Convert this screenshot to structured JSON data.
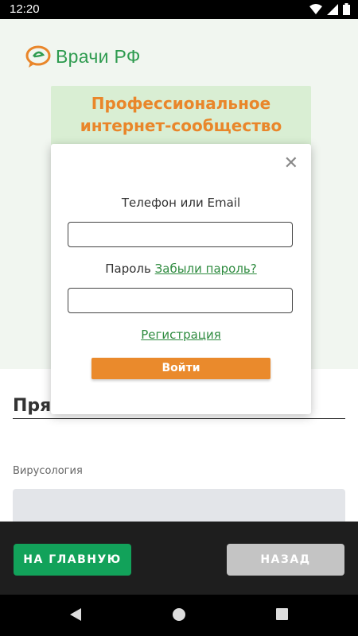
{
  "status_bar": {
    "time": "12:20"
  },
  "header": {
    "logo_text": "Врачи РФ"
  },
  "banner": {
    "line1": "Профессиональное",
    "line2": "интернет-сообщество"
  },
  "background_content": {
    "title": "Прям",
    "subtitle": "Вирусология"
  },
  "login_modal": {
    "close_symbol": "✕",
    "login_label": "Телефон или Email",
    "login_value": "",
    "password_label": "Пароль",
    "forgot_link": "Забыли пароль?",
    "password_value": "",
    "register_link": "Регистрация",
    "submit_label": "Войти"
  },
  "bottom_bar": {
    "home_label": "НА ГЛАВНУЮ",
    "back_label": "НАЗАД"
  },
  "colors": {
    "accent_orange": "#ea8a2c",
    "brand_green": "#2e9b4f",
    "home_button": "#12a25a",
    "back_button": "#c4c4c4"
  },
  "icons": [
    "wifi-icon",
    "signal-icon",
    "battery-icon",
    "logo-icon",
    "close-icon",
    "nav-back-icon",
    "nav-home-icon",
    "nav-recents-icon"
  ]
}
